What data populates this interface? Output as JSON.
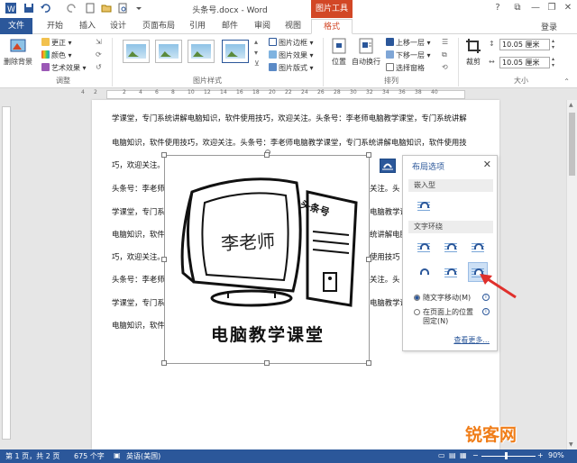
{
  "window": {
    "title": "头条号.docx - Word",
    "context_tab_group": "图片工具",
    "signin": "登录",
    "controls": [
      "?",
      "—",
      "❐",
      "✕"
    ]
  },
  "tabs": [
    {
      "label": "文件"
    },
    {
      "label": "开始"
    },
    {
      "label": "插入"
    },
    {
      "label": "设计"
    },
    {
      "label": "页面布局"
    },
    {
      "label": "引用"
    },
    {
      "label": "邮件"
    },
    {
      "label": "审阅"
    },
    {
      "label": "视图"
    },
    {
      "label": "格式"
    }
  ],
  "ribbon": {
    "adjust": {
      "remove_bg": "删除背景",
      "corrections": "更正",
      "color": "颜色",
      "artistic": "艺术效果",
      "group_label": "调整"
    },
    "styles": {
      "border": "图片边框",
      "effects": "图片效果",
      "layout": "图片版式",
      "group_label": "图片样式"
    },
    "arrange": {
      "position": "位置",
      "wrap": "自动换行",
      "forward": "上移一层",
      "backward": "下移一层",
      "selection": "选择窗格",
      "group_label": "排列"
    },
    "size": {
      "crop": "裁剪",
      "height": "10.05 厘米",
      "width": "10.05 厘米",
      "group_label": "大小"
    }
  },
  "ruler": {
    "ticks": [
      "4",
      "2",
      "",
      "2",
      "4",
      "6",
      "8",
      "10",
      "12",
      "14",
      "16",
      "18",
      "20",
      "22",
      "24",
      "26",
      "28",
      "30",
      "32",
      "34",
      "36",
      "38",
      "40"
    ]
  },
  "document": {
    "lines": [
      "学课堂，专门系统讲解电脑知识，软件使用技巧，欢迎关注。头条号：李老师电脑教学课堂，专门系统讲解",
      "电脑知识，软件使用技巧，欢迎关注。头条号：李老师电脑教学课堂，专门系统讲解电脑知识，软件使用技",
      "巧，欢迎关注。",
      "头条号：李老师",
      "学课堂，专门系",
      "电脑知识，软件",
      "巧，欢迎关注。",
      "头条号：李老师",
      "学课堂，专门系",
      "电脑知识，软件"
    ],
    "right_fragments": [
      "关注。头",
      "电脑教学课",
      "统讲解电脑",
      "使用技巧",
      "关注。头",
      "电脑教学课"
    ],
    "picture": {
      "screen_text": "李老师",
      "tower_text": "头条号",
      "caption": "电脑教学课堂"
    }
  },
  "layout_options": {
    "title": "布局选项",
    "close": "✕",
    "inline_section": "嵌入型",
    "wrap_section": "文字环绕",
    "move_with_text": "随文字移动(M)",
    "fix_position": "在页面上的位置固定(N)",
    "fix_position_line1": "在页面上的位置",
    "fix_position_line2": "固定(N)",
    "see_more": "查看更多...",
    "selected_index": 5
  },
  "statusbar": {
    "page": "第 1 页，共 2 页",
    "words": "675 个字",
    "language": "英语(美国)",
    "zoom": "90%"
  },
  "watermark": {
    "text": "锐客网"
  },
  "colors": {
    "accent": "#2b579a",
    "context_tab": "#d24726",
    "arrow": "#e0302c",
    "watermark": "#f07d18"
  }
}
